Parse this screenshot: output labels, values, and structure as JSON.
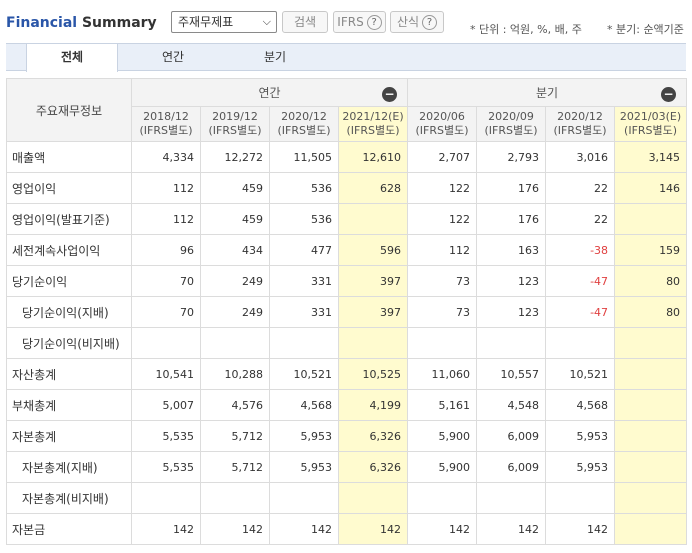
{
  "header": {
    "title_part1": "Financial",
    "title_part2": " Summary",
    "select_value": "주재무제표",
    "search_label": "검색",
    "ifrs_label": "IFRS",
    "formula_label": "산식",
    "help_glyph": "?",
    "unit_note": "* 단위 : 억원, %, 배, 주",
    "quarter_note": "* 분기: 순액기준"
  },
  "tabs": [
    "전체",
    "연간",
    "분기"
  ],
  "active_tab": "전체",
  "table": {
    "row_header_label": "주요재무정보",
    "group_annual": "연간",
    "group_quarter": "분기",
    "collapse_glyph": "−",
    "columns": [
      {
        "date": "2018/12",
        "basis": "(IFRS별도)",
        "estimate": false
      },
      {
        "date": "2019/12",
        "basis": "(IFRS별도)",
        "estimate": false
      },
      {
        "date": "2020/12",
        "basis": "(IFRS별도)",
        "estimate": false
      },
      {
        "date": "2021/12(E)",
        "basis": "(IFRS별도)",
        "estimate": true
      },
      {
        "date": "2020/06",
        "basis": "(IFRS별도)",
        "estimate": false
      },
      {
        "date": "2020/09",
        "basis": "(IFRS별도)",
        "estimate": false
      },
      {
        "date": "2020/12",
        "basis": "(IFRS별도)",
        "estimate": false
      },
      {
        "date": "2021/03(E)",
        "basis": "(IFRS별도)",
        "estimate": true
      }
    ],
    "rows": [
      {
        "label": "매출액",
        "indent": false,
        "values": [
          "4,334",
          "12,272",
          "11,505",
          "12,610",
          "2,707",
          "2,793",
          "3,016",
          "3,145"
        ]
      },
      {
        "label": "영업이익",
        "indent": false,
        "values": [
          "112",
          "459",
          "536",
          "628",
          "122",
          "176",
          "22",
          "146"
        ]
      },
      {
        "label": "영업이익(발표기준)",
        "indent": false,
        "values": [
          "112",
          "459",
          "536",
          "",
          "122",
          "176",
          "22",
          ""
        ]
      },
      {
        "label": "세전계속사업이익",
        "indent": false,
        "values": [
          "96",
          "434",
          "477",
          "596",
          "112",
          "163",
          "-38",
          "159"
        ]
      },
      {
        "label": "당기순이익",
        "indent": false,
        "values": [
          "70",
          "249",
          "331",
          "397",
          "73",
          "123",
          "-47",
          "80"
        ]
      },
      {
        "label": "당기순이익(지배)",
        "indent": true,
        "values": [
          "70",
          "249",
          "331",
          "397",
          "73",
          "123",
          "-47",
          "80"
        ]
      },
      {
        "label": "당기순이익(비지배)",
        "indent": true,
        "values": [
          "",
          "",
          "",
          "",
          "",
          "",
          "",
          ""
        ]
      },
      {
        "label": "자산총계",
        "indent": false,
        "values": [
          "10,541",
          "10,288",
          "10,521",
          "10,525",
          "11,060",
          "10,557",
          "10,521",
          ""
        ]
      },
      {
        "label": "부채총계",
        "indent": false,
        "values": [
          "5,007",
          "4,576",
          "4,568",
          "4,199",
          "5,161",
          "4,548",
          "4,568",
          ""
        ]
      },
      {
        "label": "자본총계",
        "indent": false,
        "values": [
          "5,535",
          "5,712",
          "5,953",
          "6,326",
          "5,900",
          "6,009",
          "5,953",
          ""
        ]
      },
      {
        "label": "자본총계(지배)",
        "indent": true,
        "values": [
          "5,535",
          "5,712",
          "5,953",
          "6,326",
          "5,900",
          "6,009",
          "5,953",
          ""
        ]
      },
      {
        "label": "자본총계(비지배)",
        "indent": true,
        "values": [
          "",
          "",
          "",
          "",
          "",
          "",
          "",
          ""
        ]
      },
      {
        "label": "자본금",
        "indent": false,
        "values": [
          "142",
          "142",
          "142",
          "142",
          "142",
          "142",
          "142",
          ""
        ]
      }
    ]
  }
}
